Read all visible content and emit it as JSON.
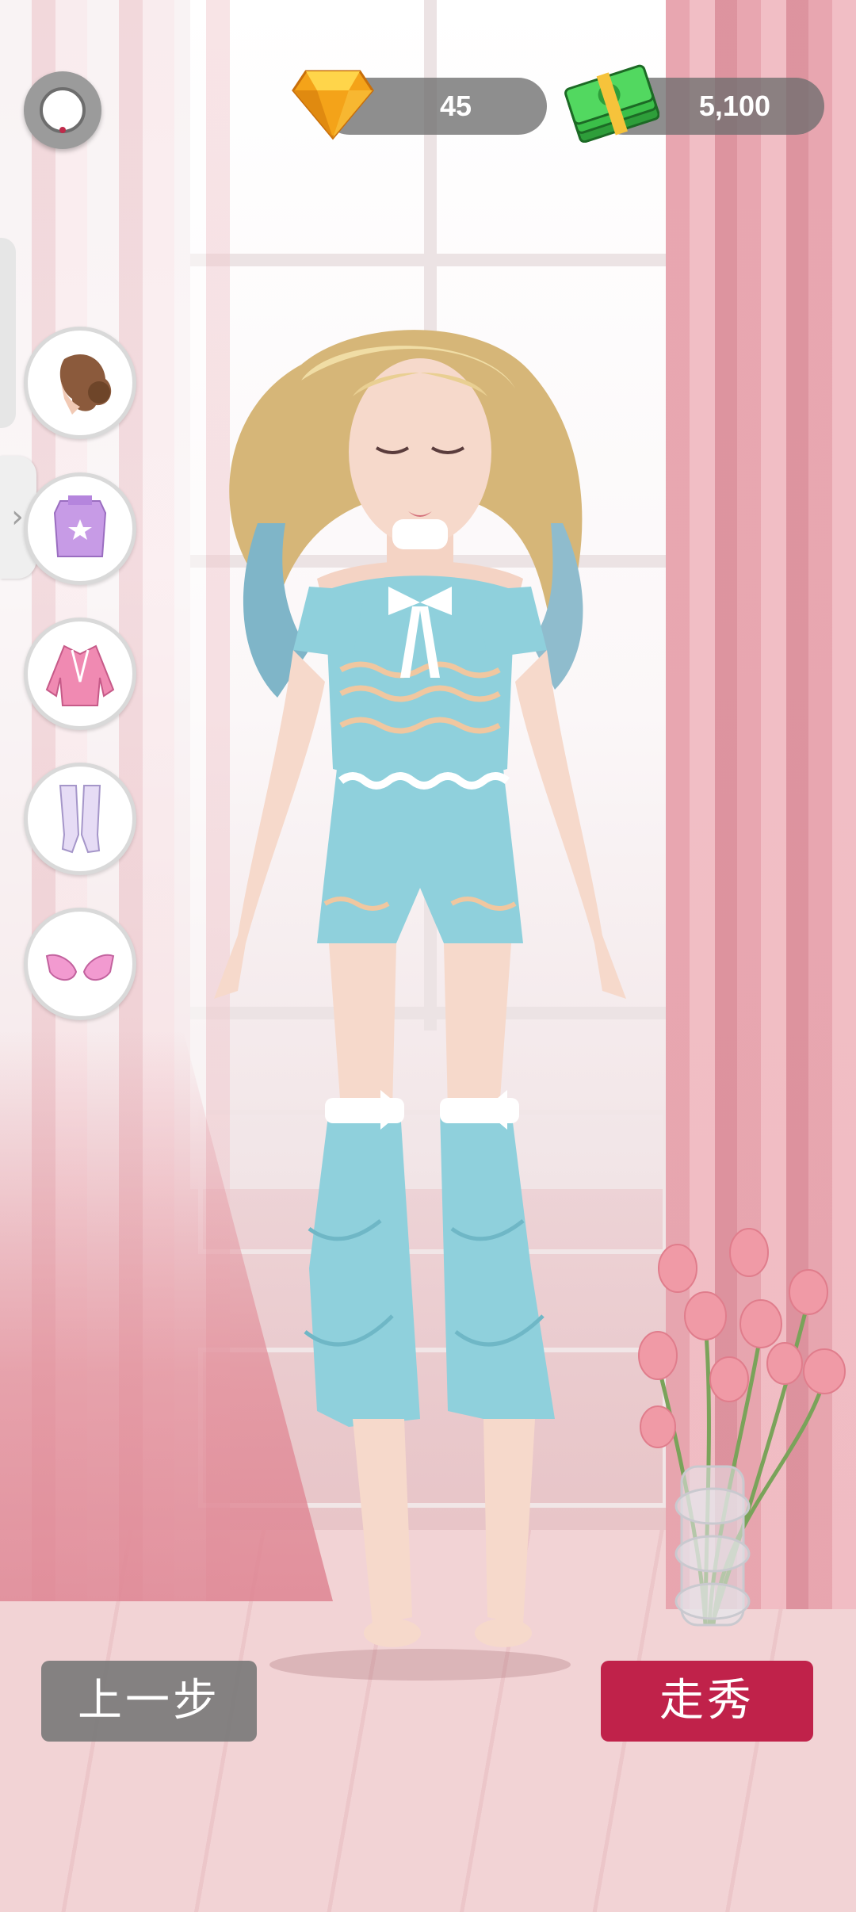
{
  "hud": {
    "gems": "45",
    "cash": "5,100"
  },
  "categories": [
    {
      "name": "hair",
      "icon": "hairstyle-icon"
    },
    {
      "name": "top",
      "icon": "crop-top-icon"
    },
    {
      "name": "jacket",
      "icon": "jacket-icon"
    },
    {
      "name": "socks",
      "icon": "leg-warmers-icon"
    },
    {
      "name": "shoes",
      "icon": "heels-icon"
    }
  ],
  "buttons": {
    "back_label": "上一步",
    "walk_label": "走秀"
  },
  "colors": {
    "accent": "#c0224a",
    "pill": "#6e6e6e",
    "outfit": "#8fd0dc"
  }
}
